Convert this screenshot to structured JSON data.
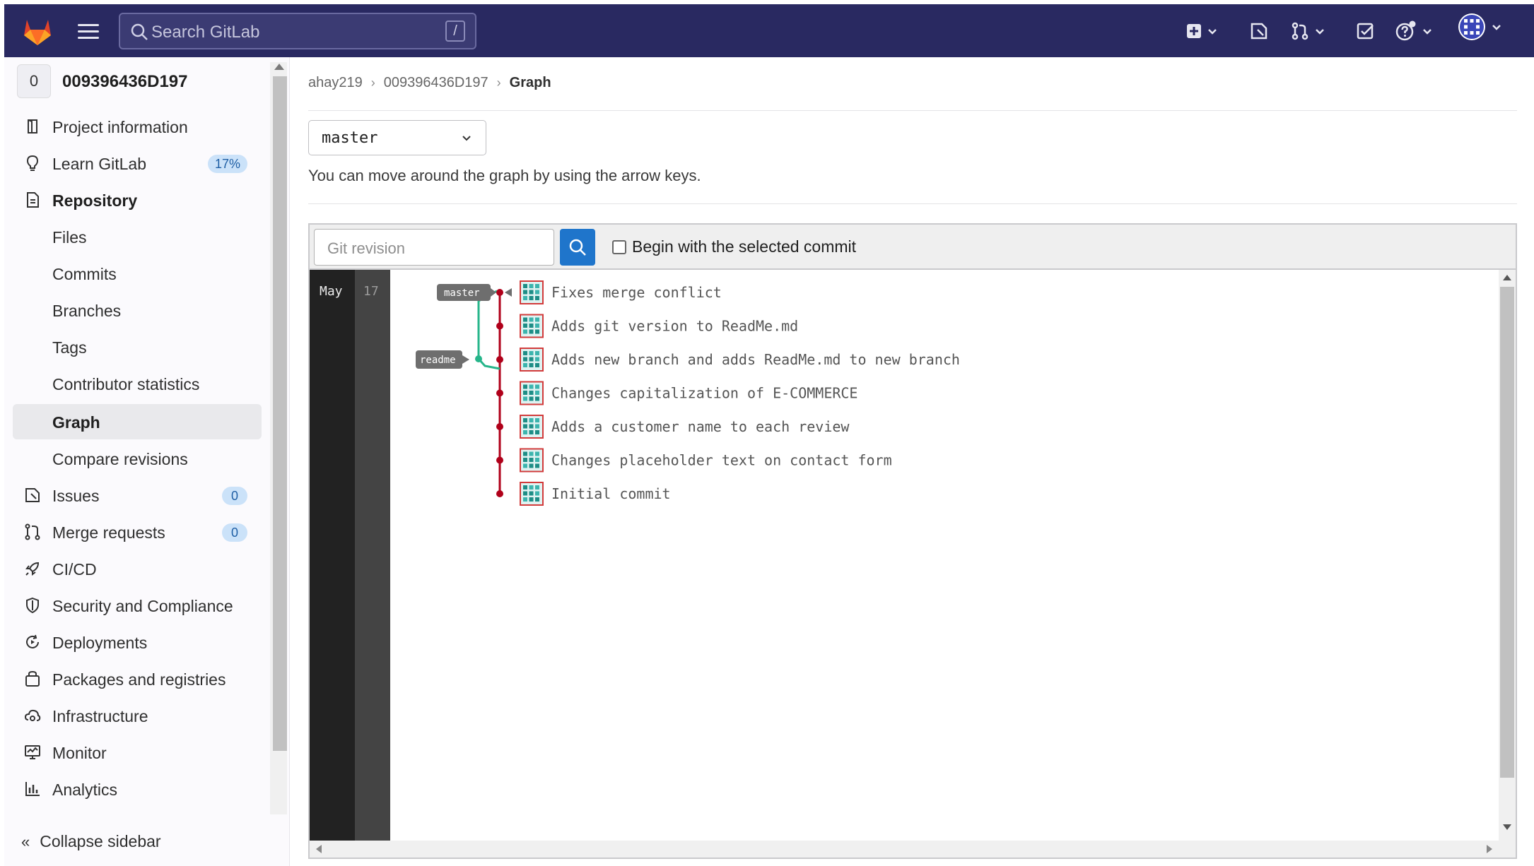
{
  "navbar": {
    "search_placeholder": "Search GitLab",
    "search_shortcut": "/"
  },
  "sidebar": {
    "project_avatar": "0",
    "project_name": "009396436D197",
    "items": [
      {
        "label": "Project information",
        "icon": "project-icon"
      },
      {
        "label": "Learn GitLab",
        "icon": "bulb-icon",
        "badge": "17%"
      },
      {
        "label": "Repository",
        "icon": "document-icon"
      },
      {
        "label": "Files"
      },
      {
        "label": "Commits"
      },
      {
        "label": "Branches"
      },
      {
        "label": "Tags"
      },
      {
        "label": "Contributor statistics"
      },
      {
        "label": "Graph"
      },
      {
        "label": "Compare revisions"
      },
      {
        "label": "Issues",
        "icon": "issues-icon",
        "badge": "0"
      },
      {
        "label": "Merge requests",
        "icon": "merge-request-icon",
        "badge": "0"
      },
      {
        "label": "CI/CD",
        "icon": "rocket-icon"
      },
      {
        "label": "Security and Compliance",
        "icon": "shield-icon"
      },
      {
        "label": "Deployments",
        "icon": "deployments-icon"
      },
      {
        "label": "Packages and registries",
        "icon": "package-icon"
      },
      {
        "label": "Infrastructure",
        "icon": "cloud-gear-icon"
      },
      {
        "label": "Monitor",
        "icon": "monitor-icon"
      },
      {
        "label": "Analytics",
        "icon": "chart-icon"
      }
    ],
    "collapse_label": "Collapse sidebar"
  },
  "breadcrumb": {
    "user": "ahay219",
    "project": "009396436D197",
    "current": "Graph"
  },
  "branch_selector": {
    "value": "master"
  },
  "hint": "You can move around the graph by using the arrow keys.",
  "graph_toolbar": {
    "revision_placeholder": "Git revision",
    "checkbox_label": "Begin with the selected commit"
  },
  "graph": {
    "month": "May",
    "day": "17",
    "labels": {
      "master": "master",
      "readme": "readme"
    },
    "commits": [
      "Fixes merge conflict",
      "Adds git version to ReadMe.md",
      "Adds new branch and adds ReadMe.md to new branch",
      "Changes capitalization of E-COMMERCE",
      "Adds a customer name to each review",
      "Changes placeholder text on contact form",
      "Initial commit"
    ]
  }
}
